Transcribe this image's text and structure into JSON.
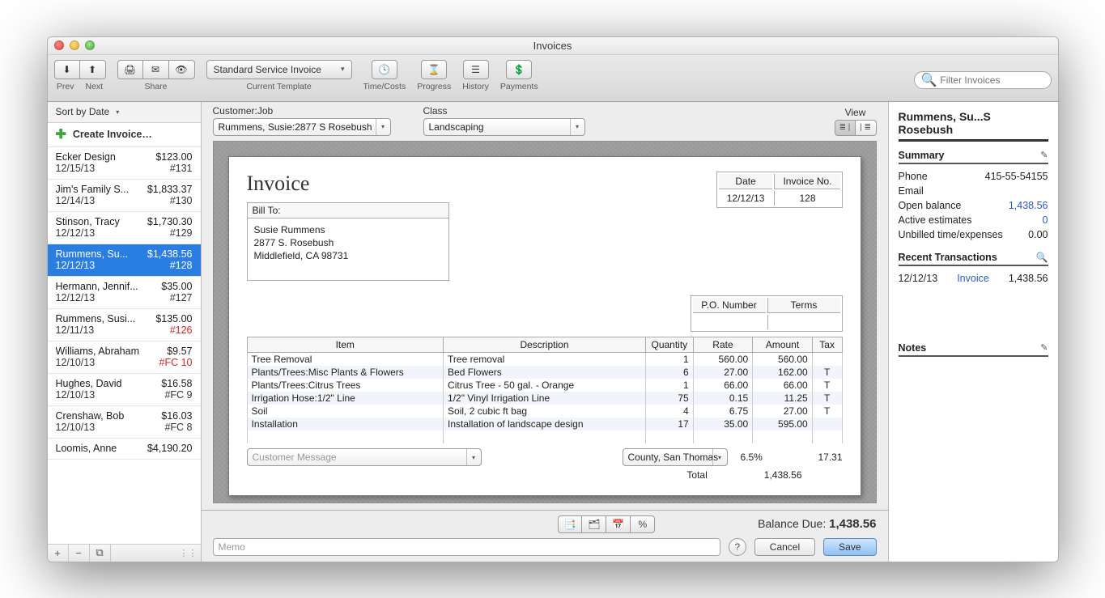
{
  "window_title": "Invoices",
  "toolbar": {
    "prev": "Prev",
    "next": "Next",
    "share": "Share",
    "template_value": "Standard Service Invoice",
    "template_label": "Current Template",
    "timecosts": "Time/Costs",
    "progress": "Progress",
    "history": "History",
    "payments": "Payments",
    "search_placeholder": "Filter Invoices"
  },
  "sidebar": {
    "sort": "Sort by Date",
    "create": "Create Invoice…",
    "items": [
      {
        "name": "Ecker Design",
        "amount": "$123.00",
        "date": "12/15/13",
        "num": "#131",
        "red": false,
        "sel": false
      },
      {
        "name": "Jim's Family S...",
        "amount": "$1,833.37",
        "date": "12/14/13",
        "num": "#130",
        "red": false,
        "sel": false
      },
      {
        "name": "Stinson, Tracy",
        "amount": "$1,730.30",
        "date": "12/12/13",
        "num": "#129",
        "red": false,
        "sel": false
      },
      {
        "name": "Rummens, Su...",
        "amount": "$1,438.56",
        "date": "12/12/13",
        "num": "#128",
        "red": false,
        "sel": true
      },
      {
        "name": "Hermann, Jennif...",
        "amount": "$35.00",
        "date": "12/12/13",
        "num": "#127",
        "red": false,
        "sel": false
      },
      {
        "name": "Rummens, Susi...",
        "amount": "$135.00",
        "date": "12/11/13",
        "num": "#126",
        "red": true,
        "sel": false
      },
      {
        "name": "Williams, Abraham",
        "amount": "$9.57",
        "date": "12/10/13",
        "num": "#FC 10",
        "red": true,
        "sel": false
      },
      {
        "name": "Hughes, David",
        "amount": "$16.58",
        "date": "12/10/13",
        "num": "#FC 9",
        "red": false,
        "sel": false
      },
      {
        "name": "Crenshaw, Bob",
        "amount": "$16.03",
        "date": "12/10/13",
        "num": "#FC 8",
        "red": false,
        "sel": false
      },
      {
        "name": "Loomis, Anne",
        "amount": "$4,190.20",
        "date": "",
        "num": "",
        "red": false,
        "sel": false
      }
    ]
  },
  "form": {
    "customer_label": "Customer:Job",
    "customer_value": "Rummens, Susie:2877 S Rosebush",
    "class_label": "Class",
    "class_value": "Landscaping",
    "view_label": "View"
  },
  "invoice": {
    "title": "Invoice",
    "date_h": "Date",
    "date_v": "12/12/13",
    "num_h": "Invoice No.",
    "num_v": "128",
    "billto_label": "Bill To:",
    "billto": "Susie Rummens\n2877 S. Rosebush\nMiddlefield, CA  98731",
    "po_h": "P.O. Number",
    "terms_h": "Terms",
    "cols": {
      "item": "Item",
      "desc": "Description",
      "qty": "Quantity",
      "rate": "Rate",
      "amount": "Amount",
      "tax": "Tax"
    },
    "lines": [
      {
        "item": "Tree Removal",
        "desc": "Tree removal",
        "qty": "1",
        "rate": "560.00",
        "amount": "560.00",
        "tax": ""
      },
      {
        "item": "Plants/Trees:Misc Plants & Flowers",
        "desc": "Bed Flowers",
        "qty": "6",
        "rate": "27.00",
        "amount": "162.00",
        "tax": "T"
      },
      {
        "item": "Plants/Trees:Citrus Trees",
        "desc": "Citrus Tree - 50 gal. - Orange",
        "qty": "1",
        "rate": "66.00",
        "amount": "66.00",
        "tax": "T"
      },
      {
        "item": "Irrigation Hose:1/2\" Line",
        "desc": "1/2\"  Vinyl Irrigation Line",
        "qty": "75",
        "rate": "0.15",
        "amount": "11.25",
        "tax": "T"
      },
      {
        "item": "Soil",
        "desc": "Soil, 2 cubic ft bag",
        "qty": "4",
        "rate": "6.75",
        "amount": "27.00",
        "tax": "T"
      },
      {
        "item": "Installation",
        "desc": "Installation of landscape design",
        "qty": "17",
        "rate": "35.00",
        "amount": "595.00",
        "tax": ""
      }
    ],
    "msg_placeholder": "Customer Message",
    "tax_region": "County, San Thomas",
    "tax_rate": "6.5%",
    "tax_amt": "17.31",
    "total_label": "Total",
    "total": "1,438.56"
  },
  "footer": {
    "balance_label": "Balance Due:",
    "balance": "1,438.56",
    "memo_placeholder": "Memo",
    "cancel": "Cancel",
    "save": "Save"
  },
  "right": {
    "title": "Rummens, Su...S Rosebush",
    "summary": "Summary",
    "phone_l": "Phone",
    "phone_v": "415-55-54155",
    "email_l": "Email",
    "open_l": "Open balance",
    "open_v": "1,438.56",
    "est_l": "Active estimates",
    "est_v": "0",
    "unb_l": "Unbilled time/expenses",
    "unb_v": "0.00",
    "recent": "Recent Transactions",
    "txn_date": "12/12/13",
    "txn_type": "Invoice",
    "txn_amt": "1,438.56",
    "notes": "Notes"
  }
}
